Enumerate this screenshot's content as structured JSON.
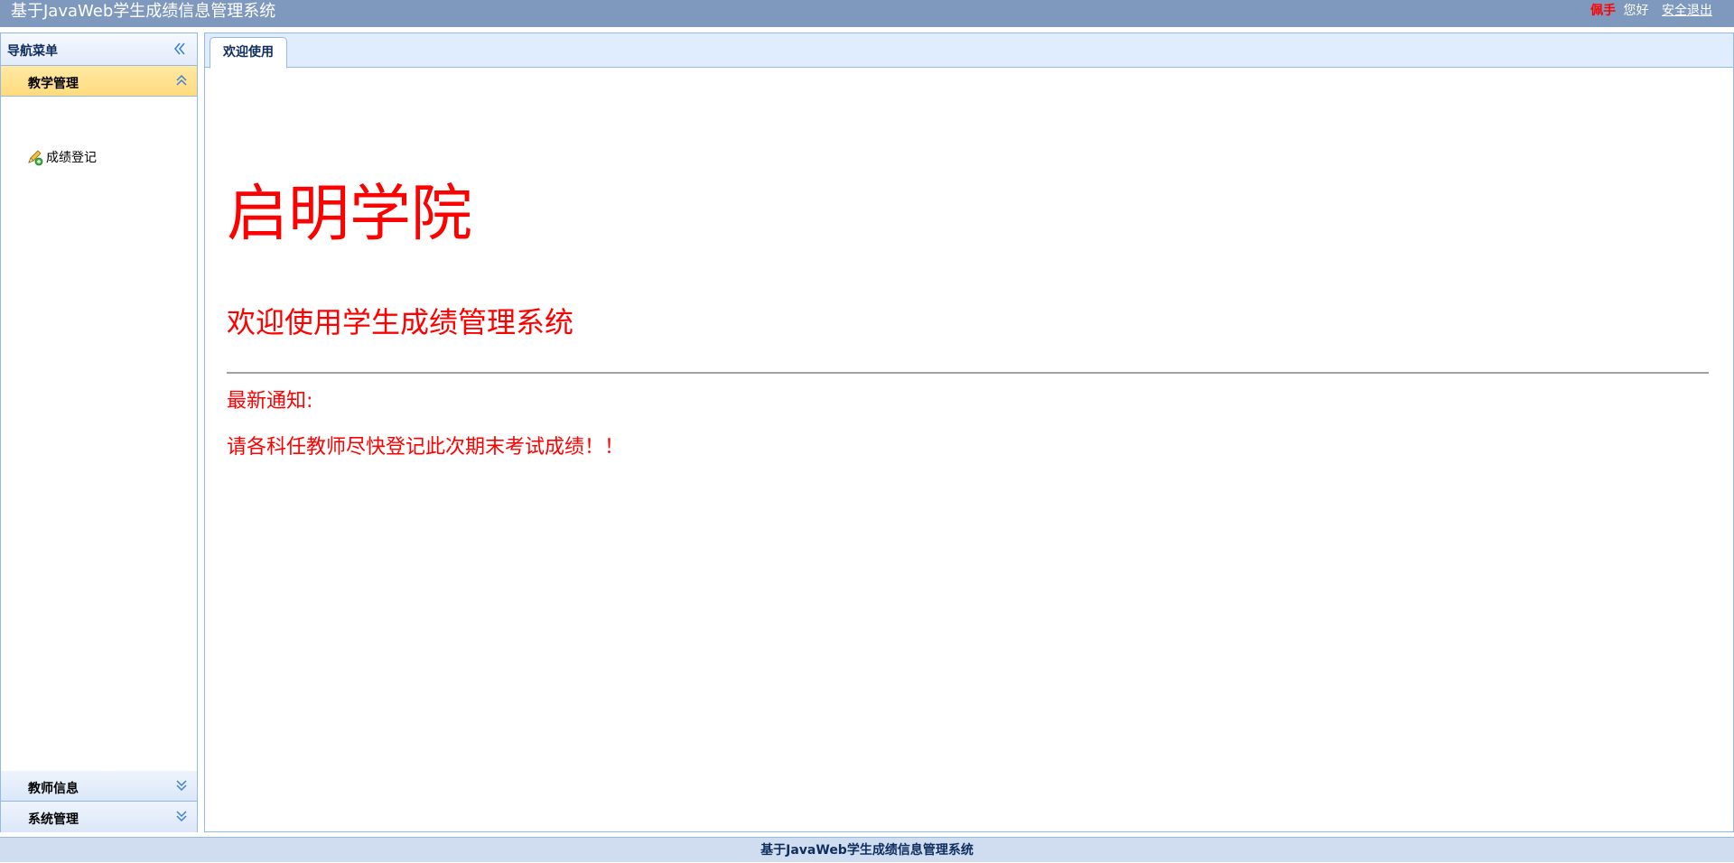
{
  "header": {
    "title": "基于JavaWeb学生成绩信息管理系统",
    "username": "佩手",
    "greeting": "您好",
    "logout_label": "安全退出"
  },
  "sidebar": {
    "title": "导航菜单",
    "panels": [
      {
        "label": "教学管理",
        "expanded": true,
        "items": [
          {
            "label": "成绩登记",
            "icon": "pencil-icon"
          }
        ]
      },
      {
        "label": "教师信息",
        "expanded": false
      },
      {
        "label": "系统管理",
        "expanded": false
      }
    ]
  },
  "tabs": [
    {
      "label": "欢迎使用",
      "active": true
    }
  ],
  "content": {
    "school_name": "启明学院",
    "welcome": "欢迎使用学生成绩管理系统",
    "notice_title": "最新通知:",
    "notice_text": "请各科任教师尽快登记此次期末考试成绩！！"
  },
  "footer": {
    "text": "基于JavaWeb学生成绩信息管理系统"
  },
  "colors": {
    "header_bg": "#7f99be",
    "accent_red": "#ff0000",
    "border_blue": "#95b8e7",
    "active_panel": "#ffe08f"
  }
}
